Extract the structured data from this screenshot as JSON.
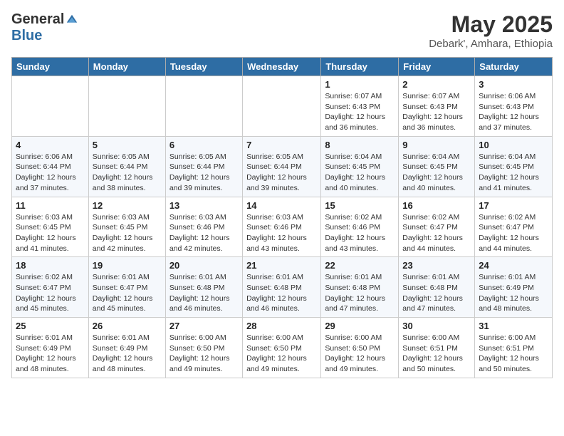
{
  "logo": {
    "general": "General",
    "blue": "Blue"
  },
  "title": "May 2025",
  "location": "Debark', Amhara, Ethiopia",
  "days_of_week": [
    "Sunday",
    "Monday",
    "Tuesday",
    "Wednesday",
    "Thursday",
    "Friday",
    "Saturday"
  ],
  "weeks": [
    [
      {
        "day": "",
        "info": ""
      },
      {
        "day": "",
        "info": ""
      },
      {
        "day": "",
        "info": ""
      },
      {
        "day": "",
        "info": ""
      },
      {
        "day": "1",
        "info": "Sunrise: 6:07 AM\nSunset: 6:43 PM\nDaylight: 12 hours\nand 36 minutes."
      },
      {
        "day": "2",
        "info": "Sunrise: 6:07 AM\nSunset: 6:43 PM\nDaylight: 12 hours\nand 36 minutes."
      },
      {
        "day": "3",
        "info": "Sunrise: 6:06 AM\nSunset: 6:43 PM\nDaylight: 12 hours\nand 37 minutes."
      }
    ],
    [
      {
        "day": "4",
        "info": "Sunrise: 6:06 AM\nSunset: 6:44 PM\nDaylight: 12 hours\nand 37 minutes."
      },
      {
        "day": "5",
        "info": "Sunrise: 6:05 AM\nSunset: 6:44 PM\nDaylight: 12 hours\nand 38 minutes."
      },
      {
        "day": "6",
        "info": "Sunrise: 6:05 AM\nSunset: 6:44 PM\nDaylight: 12 hours\nand 39 minutes."
      },
      {
        "day": "7",
        "info": "Sunrise: 6:05 AM\nSunset: 6:44 PM\nDaylight: 12 hours\nand 39 minutes."
      },
      {
        "day": "8",
        "info": "Sunrise: 6:04 AM\nSunset: 6:45 PM\nDaylight: 12 hours\nand 40 minutes."
      },
      {
        "day": "9",
        "info": "Sunrise: 6:04 AM\nSunset: 6:45 PM\nDaylight: 12 hours\nand 40 minutes."
      },
      {
        "day": "10",
        "info": "Sunrise: 6:04 AM\nSunset: 6:45 PM\nDaylight: 12 hours\nand 41 minutes."
      }
    ],
    [
      {
        "day": "11",
        "info": "Sunrise: 6:03 AM\nSunset: 6:45 PM\nDaylight: 12 hours\nand 41 minutes."
      },
      {
        "day": "12",
        "info": "Sunrise: 6:03 AM\nSunset: 6:45 PM\nDaylight: 12 hours\nand 42 minutes."
      },
      {
        "day": "13",
        "info": "Sunrise: 6:03 AM\nSunset: 6:46 PM\nDaylight: 12 hours\nand 42 minutes."
      },
      {
        "day": "14",
        "info": "Sunrise: 6:03 AM\nSunset: 6:46 PM\nDaylight: 12 hours\nand 43 minutes."
      },
      {
        "day": "15",
        "info": "Sunrise: 6:02 AM\nSunset: 6:46 PM\nDaylight: 12 hours\nand 43 minutes."
      },
      {
        "day": "16",
        "info": "Sunrise: 6:02 AM\nSunset: 6:47 PM\nDaylight: 12 hours\nand 44 minutes."
      },
      {
        "day": "17",
        "info": "Sunrise: 6:02 AM\nSunset: 6:47 PM\nDaylight: 12 hours\nand 44 minutes."
      }
    ],
    [
      {
        "day": "18",
        "info": "Sunrise: 6:02 AM\nSunset: 6:47 PM\nDaylight: 12 hours\nand 45 minutes."
      },
      {
        "day": "19",
        "info": "Sunrise: 6:01 AM\nSunset: 6:47 PM\nDaylight: 12 hours\nand 45 minutes."
      },
      {
        "day": "20",
        "info": "Sunrise: 6:01 AM\nSunset: 6:48 PM\nDaylight: 12 hours\nand 46 minutes."
      },
      {
        "day": "21",
        "info": "Sunrise: 6:01 AM\nSunset: 6:48 PM\nDaylight: 12 hours\nand 46 minutes."
      },
      {
        "day": "22",
        "info": "Sunrise: 6:01 AM\nSunset: 6:48 PM\nDaylight: 12 hours\nand 47 minutes."
      },
      {
        "day": "23",
        "info": "Sunrise: 6:01 AM\nSunset: 6:48 PM\nDaylight: 12 hours\nand 47 minutes."
      },
      {
        "day": "24",
        "info": "Sunrise: 6:01 AM\nSunset: 6:49 PM\nDaylight: 12 hours\nand 48 minutes."
      }
    ],
    [
      {
        "day": "25",
        "info": "Sunrise: 6:01 AM\nSunset: 6:49 PM\nDaylight: 12 hours\nand 48 minutes."
      },
      {
        "day": "26",
        "info": "Sunrise: 6:01 AM\nSunset: 6:49 PM\nDaylight: 12 hours\nand 48 minutes."
      },
      {
        "day": "27",
        "info": "Sunrise: 6:00 AM\nSunset: 6:50 PM\nDaylight: 12 hours\nand 49 minutes."
      },
      {
        "day": "28",
        "info": "Sunrise: 6:00 AM\nSunset: 6:50 PM\nDaylight: 12 hours\nand 49 minutes."
      },
      {
        "day": "29",
        "info": "Sunrise: 6:00 AM\nSunset: 6:50 PM\nDaylight: 12 hours\nand 49 minutes."
      },
      {
        "day": "30",
        "info": "Sunrise: 6:00 AM\nSunset: 6:51 PM\nDaylight: 12 hours\nand 50 minutes."
      },
      {
        "day": "31",
        "info": "Sunrise: 6:00 AM\nSunset: 6:51 PM\nDaylight: 12 hours\nand 50 minutes."
      }
    ]
  ]
}
